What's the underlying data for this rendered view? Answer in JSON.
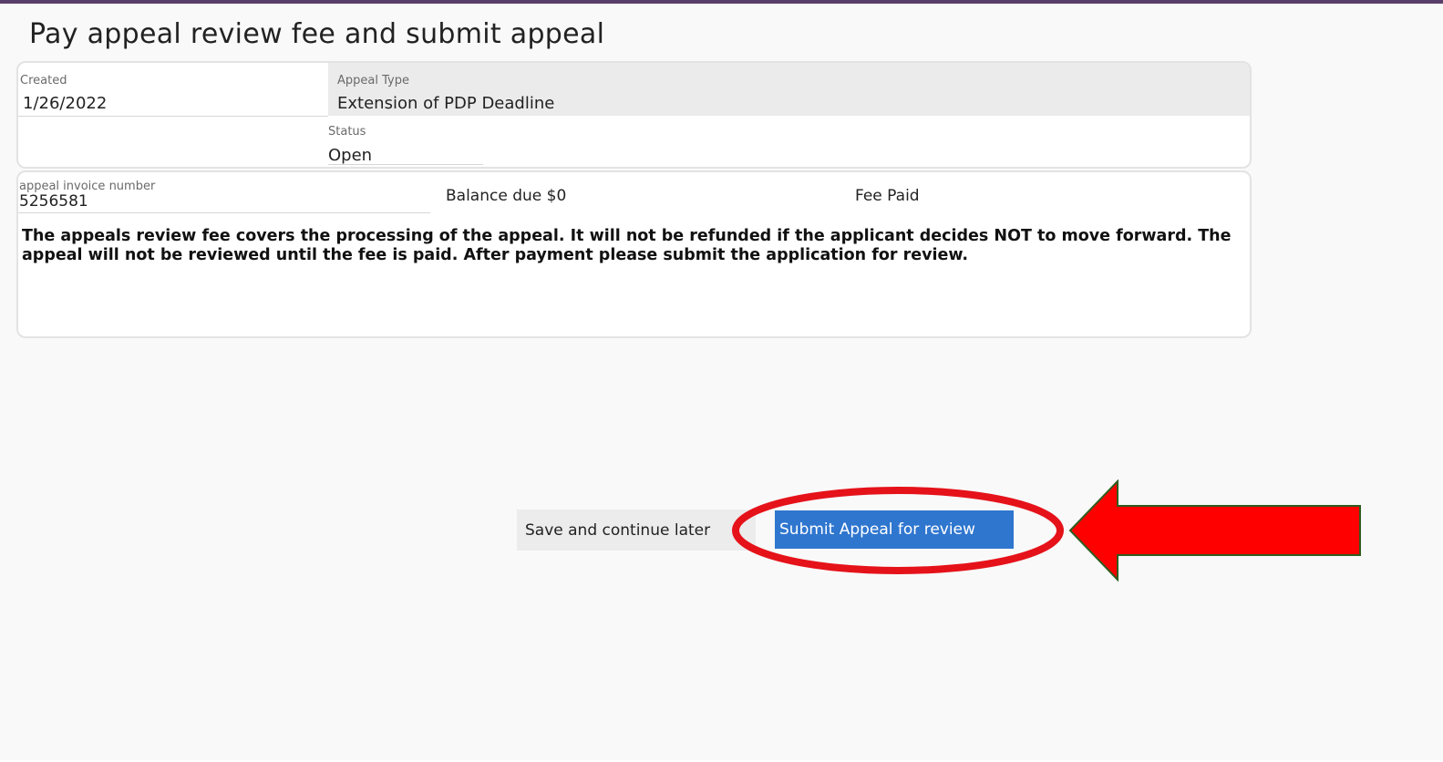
{
  "page": {
    "title": "Pay appeal review fee and submit appeal"
  },
  "details": {
    "created_label": "Created",
    "created_value": "1/26/2022",
    "appeal_type_label": "Appeal Type",
    "appeal_type_value": "Extension of PDP Deadline",
    "status_label": "Status",
    "status_value": "Open"
  },
  "fee": {
    "invoice_label": "appeal invoice number",
    "invoice_value": "5256581",
    "balance_text": "Balance due $0",
    "fee_status": "Fee Paid",
    "notice": "The appeals review fee covers the processing of the appeal.  It will not be refunded if the applicant decides NOT to move forward.  The appeal will not be reviewed until the fee is paid.  After payment please submit the application for review."
  },
  "actions": {
    "save_label": "Save and continue later",
    "submit_label": "Submit Appeal for review"
  },
  "colors": {
    "accent_rule": "#5a3f6b",
    "submit_button": "#2f76cf",
    "annotation_red": "#ff0000",
    "annotation_outline": "#2f5c1e"
  }
}
